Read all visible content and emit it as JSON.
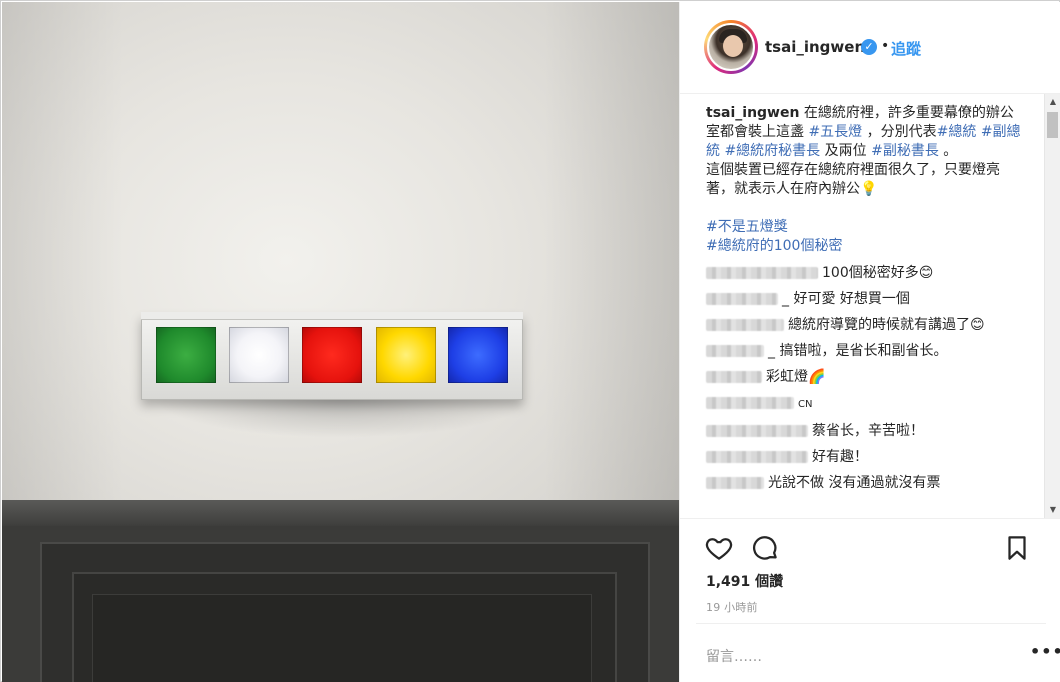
{
  "post": {
    "username": "tsai_ingwen",
    "verified_mark": "✓",
    "dot": "•",
    "follow_label": "追蹤"
  },
  "caption": {
    "username": "tsai_ingwen",
    "line1_a": " 在總統府裡，許多重要幕僚的辦公室都會裝上這盞 ",
    "tag_wuchang": "#五長燈",
    "line1_b": " ，分別代表",
    "tag_zongtong": "#總統",
    "sep1": " ",
    "tag_fuzongtong": "#副總統",
    "sep2": " ",
    "tag_mishuzhang": "#總統府秘書長",
    "line1_c": " 及兩位 ",
    "tag_fumishuzhang": "#副秘書長",
    "line1_d": " 。",
    "line2": "這個裝置已經存在總統府裡面很久了，只要燈亮著，就表示人在府內辦公",
    "bulb": "💡",
    "hashtag_a": "#不是五燈獎",
    "hashtag_b": "#總統府的100個秘密"
  },
  "comments": [
    {
      "text": "100個秘密好多😊"
    },
    {
      "text": "_ 好可愛 好想買一個"
    },
    {
      "text": "總統府導覽的時候就有講過了😊"
    },
    {
      "text": "_ 搞错啦，是省长和副省长。"
    },
    {
      "text": "彩虹燈🌈"
    },
    {
      "text": "CN"
    },
    {
      "text": "蔡省长，辛苦啦！"
    },
    {
      "text": "好有趣！"
    },
    {
      "text": "光說不做 沒有通過就沒有票"
    }
  ],
  "actions": {
    "likes": "1,491 個讚",
    "time": "19 小時前",
    "comment_placeholder": "留言……",
    "more": "•••"
  },
  "scrollbar": {
    "up": "▲",
    "down": "▼"
  },
  "icons": [
    "heart-icon",
    "comment-icon",
    "bookmark-icon",
    "verified-icon",
    "more-icon"
  ]
}
